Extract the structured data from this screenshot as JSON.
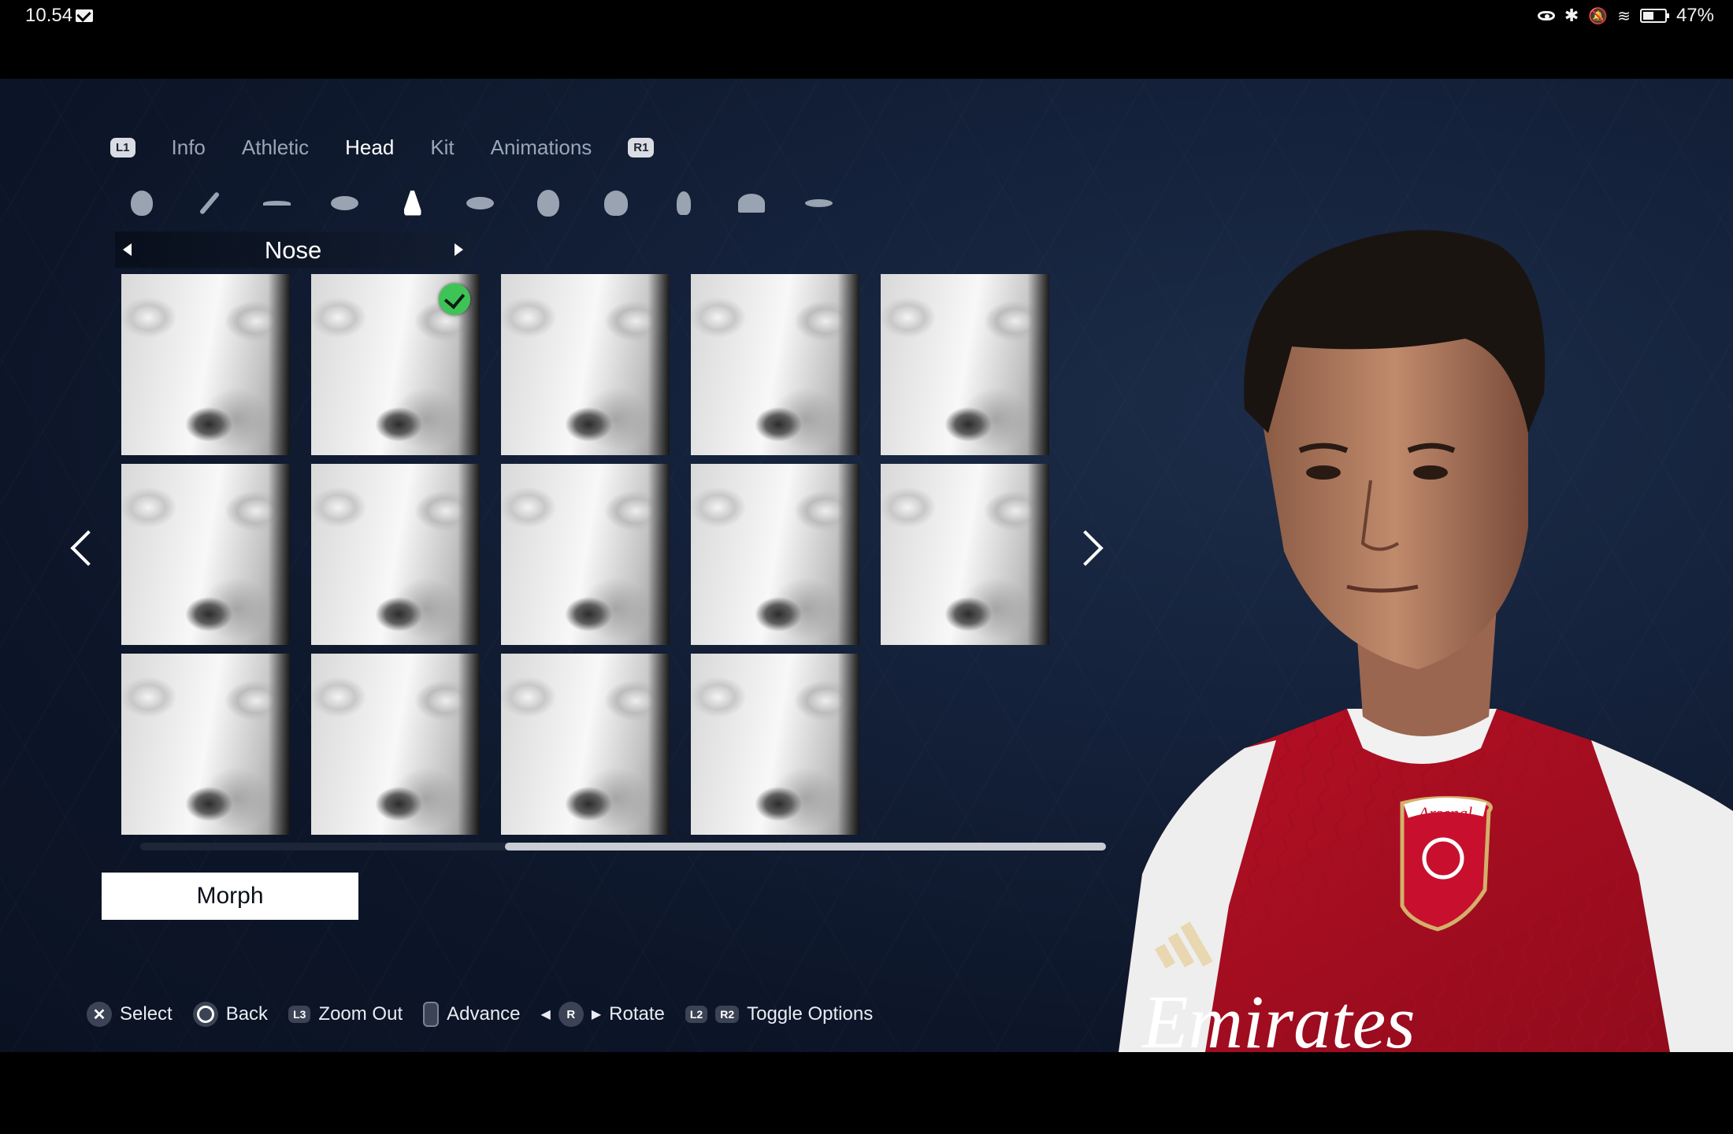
{
  "status_bar": {
    "time": "10.54",
    "battery": "47%"
  },
  "tabs": {
    "left_badge": "L1",
    "right_badge": "R1",
    "items": [
      "Info",
      "Athletic",
      "Head",
      "Kit",
      "Animations"
    ],
    "active": "Head"
  },
  "category_icons": [
    "head-shape-icon",
    "brush-icon",
    "eyebrow-icon",
    "eye-icon",
    "nose-icon",
    "lips-icon",
    "chin-icon",
    "jaw-icon",
    "ear-icon",
    "hair-icon",
    "moustache-icon"
  ],
  "selector": {
    "label": "Nose"
  },
  "grid": {
    "count": 14,
    "selected_index": 1
  },
  "morph_label": "Morph",
  "hints": {
    "select": "Select",
    "back": "Back",
    "zoom_out_badge": "L3",
    "zoom_out": "Zoom Out",
    "advance": "Advance",
    "rotate_badge": "R",
    "rotate": "Rotate",
    "l2_badge": "L2",
    "r2_badge": "R2",
    "toggle_options": "Toggle Options"
  },
  "player": {
    "crest_text": "Arsenal",
    "sponsor": "Emirates"
  },
  "colors": {
    "kit_red": "#c8102e",
    "kit_white": "#f2f2f2",
    "check_green": "#3ec456",
    "background": "#0d1629"
  }
}
